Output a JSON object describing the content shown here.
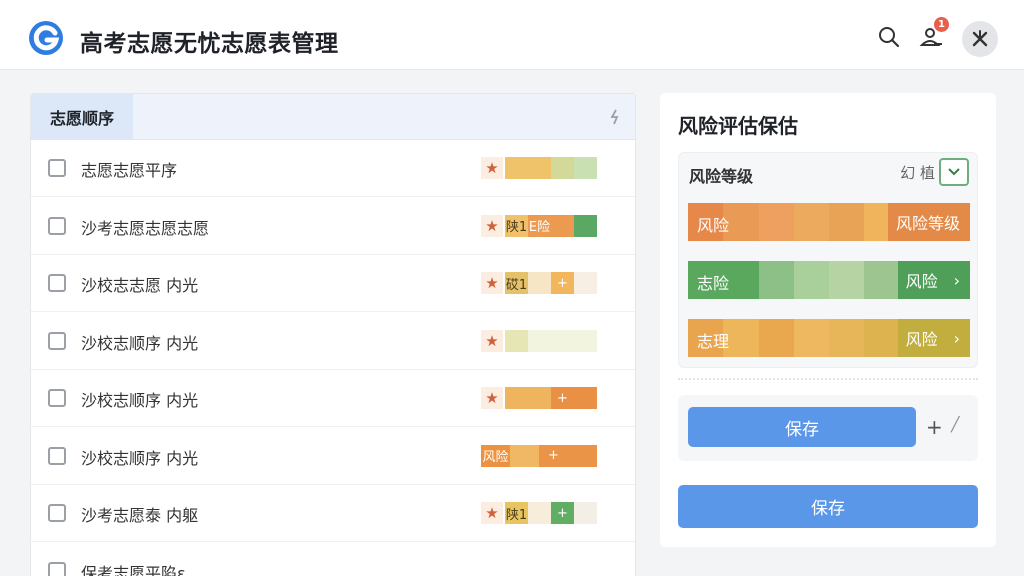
{
  "header": {
    "title": "高考志愿无忧志愿表管理",
    "logo_icon": "g-logo-icon",
    "search_icon": "search-icon",
    "notification_icon": "user-bell-icon",
    "notification_count": "1",
    "avatar_icon": "avatar-icon"
  },
  "left_panel": {
    "tab_label": "志愿顺序",
    "rows": [
      {
        "label": "志愿志愿平序",
        "segments": [
          {
            "c": "#eec369",
            "t": ""
          },
          {
            "c": "#eec369",
            "t": ""
          },
          {
            "c": "#d3d999",
            "t": ""
          },
          {
            "c": "#c9e0b3",
            "t": ""
          }
        ]
      },
      {
        "label": "沙考志愿志愿志愿",
        "segments": [
          {
            "c": "#f0c16a",
            "t": "陕1"
          },
          {
            "c": "#ec9a50",
            "t": "E险"
          },
          {
            "c": "#ec9a50",
            "t": ""
          },
          {
            "c": "#5aa864",
            "t": ""
          }
        ]
      },
      {
        "label": "沙校志志愿 内光",
        "segments": [
          {
            "c": "#e5c26a",
            "t": "砹1"
          },
          {
            "c": "#f6e6c6",
            "t": ""
          },
          {
            "c": "#f2b65c",
            "t": "+"
          },
          {
            "c": "#f7efe3",
            "t": ""
          }
        ]
      },
      {
        "label": "沙校志顺序 内光",
        "segments": [
          {
            "c": "#e6e6b4",
            "t": ""
          },
          {
            "c": "#f2f4e0",
            "t": ""
          },
          {
            "c": "#f2f4e0",
            "t": ""
          },
          {
            "c": "#f2f4e0",
            "t": ""
          }
        ]
      },
      {
        "label": "沙校志顺序 内光",
        "segments": [
          {
            "c": "#efb45e",
            "t": ""
          },
          {
            "c": "#efb45e",
            "t": ""
          },
          {
            "c": "#ea9044",
            "t": "+"
          },
          {
            "c": "#ea9044",
            "t": ""
          }
        ]
      },
      {
        "label": "沙校志顺序 内光",
        "segments": [
          {
            "c": "#ec9240",
            "t": "风险"
          },
          {
            "c": "#f0b864",
            "t": ""
          },
          {
            "c": "#ea9448",
            "t": "+"
          },
          {
            "c": "#ea9448",
            "t": ""
          }
        ]
      },
      {
        "label": "沙考志愿泰 内躯",
        "segments": [
          {
            "c": "#e8c560",
            "t": "陕1"
          },
          {
            "c": "#f6eedb",
            "t": ""
          },
          {
            "c": "#5fae63",
            "t": "+"
          },
          {
            "c": "#f3efe7",
            "t": ""
          }
        ]
      },
      {
        "label": "保考志愿平陷ɛ",
        "segments": [
          {
            "c": "#ffffff",
            "t": ""
          },
          {
            "c": "#ffffff",
            "t": ""
          },
          {
            "c": "#ffffff",
            "t": ""
          },
          {
            "c": "#ffffff",
            "t": ""
          }
        ]
      }
    ]
  },
  "right_panel": {
    "title": "风险评估保估",
    "risk_header": "风险等级",
    "risk_tools": "幻 植",
    "bars": [
      {
        "left": "风险",
        "right": "风险等级",
        "arrow": "",
        "colors": [
          "#e5884a",
          "#e99b56",
          "#eea060",
          "#ecaa5e",
          "#e8a356",
          "#f0b45c",
          "#eea45a",
          "#e48a48"
        ]
      },
      {
        "left": "志险",
        "right": "风险",
        "arrow": "›",
        "colors": [
          "#5aa85e",
          "#5aa85e",
          "#8cc086",
          "#a9cf9a",
          "#b6d4a3",
          "#9cc590",
          "#6db36c",
          "#4f9f58"
        ]
      },
      {
        "left": "志理",
        "right": "风险",
        "arrow": "›",
        "colors": [
          "#e8a54e",
          "#eeb65a",
          "#e9a84e",
          "#eeb860",
          "#e7b658",
          "#dcb34e",
          "#cfb047",
          "#c2ae3e"
        ]
      }
    ],
    "save_inner_label": "保存",
    "save_main_label": "保存"
  }
}
